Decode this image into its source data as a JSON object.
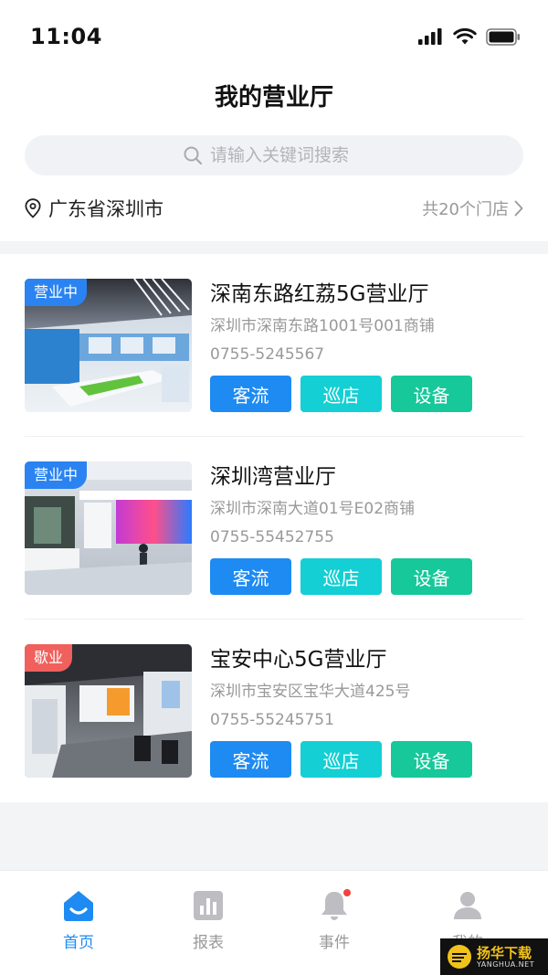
{
  "status_bar": {
    "time": "11:04"
  },
  "header": {
    "title": "我的营业厅"
  },
  "search": {
    "placeholder": "请输入关键词搜索"
  },
  "location": {
    "city": "广东省深圳市",
    "store_count": "共20个门店"
  },
  "stores": [
    {
      "status": "营业中",
      "name": "深南东路红荔5G营业厅",
      "address": "深圳市深南东路1001号001商铺",
      "phone": "0755-5245567",
      "actions": [
        "客流",
        "巡店",
        "设备"
      ]
    },
    {
      "status": "营业中",
      "name": "深圳湾营业厅",
      "address": "深圳市深南大道01号E02商铺",
      "phone": "0755-55452755",
      "actions": [
        "客流",
        "巡店",
        "设备"
      ]
    },
    {
      "status": "歇业",
      "name": "宝安中心5G营业厅",
      "address": "深圳市宝安区宝华大道425号",
      "phone": "0755-55245751",
      "actions": [
        "客流",
        "巡店",
        "设备"
      ]
    }
  ],
  "tabbar": {
    "tabs": [
      "首页",
      "报表",
      "事件",
      "我的"
    ],
    "active": "首页"
  },
  "watermark": {
    "brand": "扬华下载",
    "url": "YANGHUA.NET"
  },
  "colors": {
    "primary": "#1e8bf2",
    "cyan": "#14cfd3",
    "green": "#16c89a",
    "closed": "#f0605c",
    "notify": "#f0443c"
  }
}
